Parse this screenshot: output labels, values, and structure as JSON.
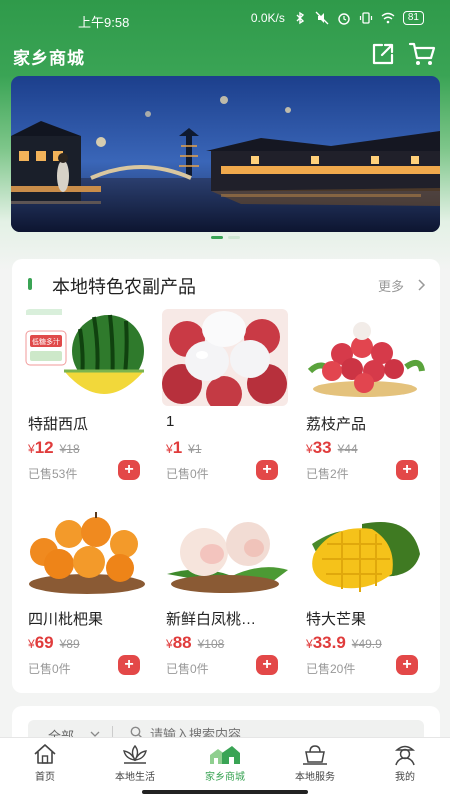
{
  "status_bar": {
    "time": "上午9:58",
    "network_speed": "0.0K/s",
    "battery": "81"
  },
  "header": {
    "title": "家乡商城",
    "share_icon": "share-icon",
    "cart_icon": "cart-icon"
  },
  "colors": {
    "brand_green": "#3aa455",
    "price_red": "#e03c3c",
    "add_button_red": "#e34848"
  },
  "banner": {
    "slides": 2,
    "active_slide": 1
  },
  "section": {
    "title": "本地特色农副产品",
    "more_label": "更多"
  },
  "products": [
    {
      "name": "特甜西瓜",
      "currency": "¥",
      "price": "12",
      "original_price": "¥18",
      "sold": "已售53件",
      "add_label": "+"
    },
    {
      "name": "1",
      "currency": "¥",
      "price": "1",
      "original_price": "¥1",
      "sold": "已售0件",
      "add_label": "+"
    },
    {
      "name": "荔枝产品",
      "currency": "¥",
      "price": "33",
      "original_price": "¥44",
      "sold": "已售2件",
      "add_label": "+"
    },
    {
      "name": "四川枇杷果",
      "currency": "¥",
      "price": "69",
      "original_price": "¥89",
      "sold": "已售0件",
      "add_label": "+"
    },
    {
      "name": "新鲜白凤桃…",
      "currency": "¥",
      "price": "88",
      "original_price": "¥108",
      "sold": "已售0件",
      "add_label": "+"
    },
    {
      "name": "特大芒果",
      "currency": "¥",
      "price": "33.9",
      "original_price": "¥49.9",
      "sold": "已售20件",
      "add_label": "+"
    }
  ],
  "product_badges": {
    "watermelon_badge": "低糖多汁"
  },
  "search": {
    "category": "全部",
    "placeholder": "请输入搜索内容"
  },
  "tabbar": [
    {
      "label": "首页",
      "icon": "home-icon"
    },
    {
      "label": "本地生活",
      "icon": "lotus-icon"
    },
    {
      "label": "家乡商城",
      "icon": "village-icon",
      "active": true
    },
    {
      "label": "本地服务",
      "icon": "service-icon"
    },
    {
      "label": "我的",
      "icon": "profile-icon"
    }
  ]
}
